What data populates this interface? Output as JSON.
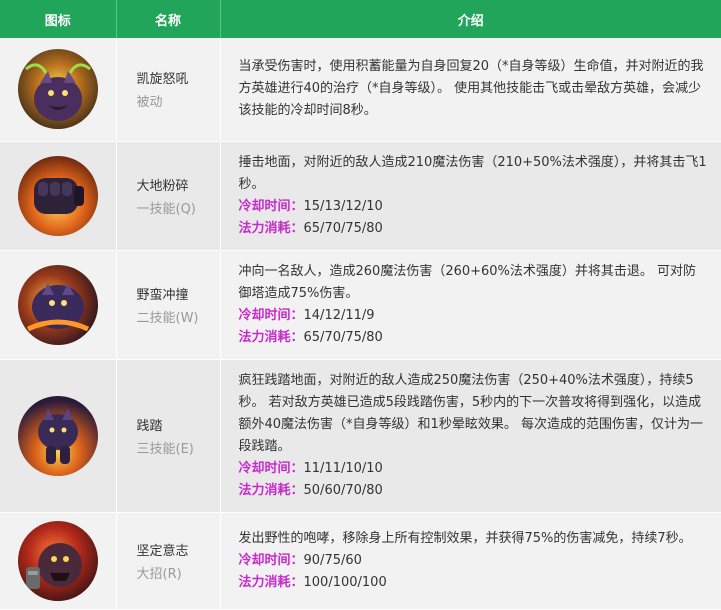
{
  "header": {
    "icon": "图标",
    "name": "名称",
    "desc": "介绍"
  },
  "rows": [
    {
      "icon": "roar-icon",
      "name": "凯旋怒吼",
      "type": "被动",
      "desc": "当承受伤害时，使用积蓄能量为自身回复20（*自身等级）生命值，并对附近的我方英雄进行40的治疗（*自身等级）。 使用其他技能击飞或击晕敌方英雄，会减少该技能的冷却时间8秒。",
      "cooldown_label": "",
      "cooldown": "",
      "cost_label": "",
      "cost": ""
    },
    {
      "icon": "fist-icon",
      "name": "大地粉碎",
      "type": "一技能(Q)",
      "desc": "捶击地面，对附近的敌人造成210魔法伤害（210+50%法术强度），并将其击飞1秒。",
      "cooldown_label": "冷却时间：",
      "cooldown": "15/13/12/10",
      "cost_label": "法力消耗：",
      "cost": "65/70/75/80"
    },
    {
      "icon": "charge-icon",
      "name": "野蛮冲撞",
      "type": "二技能(W)",
      "desc": "冲向一名敌人，造成260魔法伤害（260+60%法术强度）并将其击退。 可对防御塔造成75%伤害。",
      "cooldown_label": "冷却时间：",
      "cooldown": "14/12/11/9",
      "cost_label": "法力消耗：",
      "cost": "65/70/75/80"
    },
    {
      "icon": "stomp-icon",
      "name": "践踏",
      "type": "三技能(E)",
      "desc": "疯狂践踏地面，对附近的敌人造成250魔法伤害（250+40%法术强度），持续5秒。 若对敌方英雄已造成5段践踏伤害，5秒内的下一次普攻将得到强化，以造成额外40魔法伤害（*自身等级）和1秒晕眩效果。 每次造成的范围伤害，仅计为一段践踏。",
      "cooldown_label": "冷却时间：",
      "cooldown": "11/11/10/10",
      "cost_label": "法力消耗：",
      "cost": "50/60/70/80"
    },
    {
      "icon": "resolve-icon",
      "name": "坚定意志",
      "type": "大招(R)",
      "desc": "发出野性的咆哮，移除身上所有控制效果，并获得75%的伤害减免，持续7秒。",
      "cooldown_label": "冷却时间：",
      "cooldown": "90/75/60",
      "cost_label": "法力消耗：",
      "cost": "100/100/100"
    }
  ],
  "colors": {
    "header_bg": "#21a55a",
    "stat_label": "#c72acd",
    "row_odd": "#f2f2f2",
    "row_even": "#e9e9e9"
  }
}
